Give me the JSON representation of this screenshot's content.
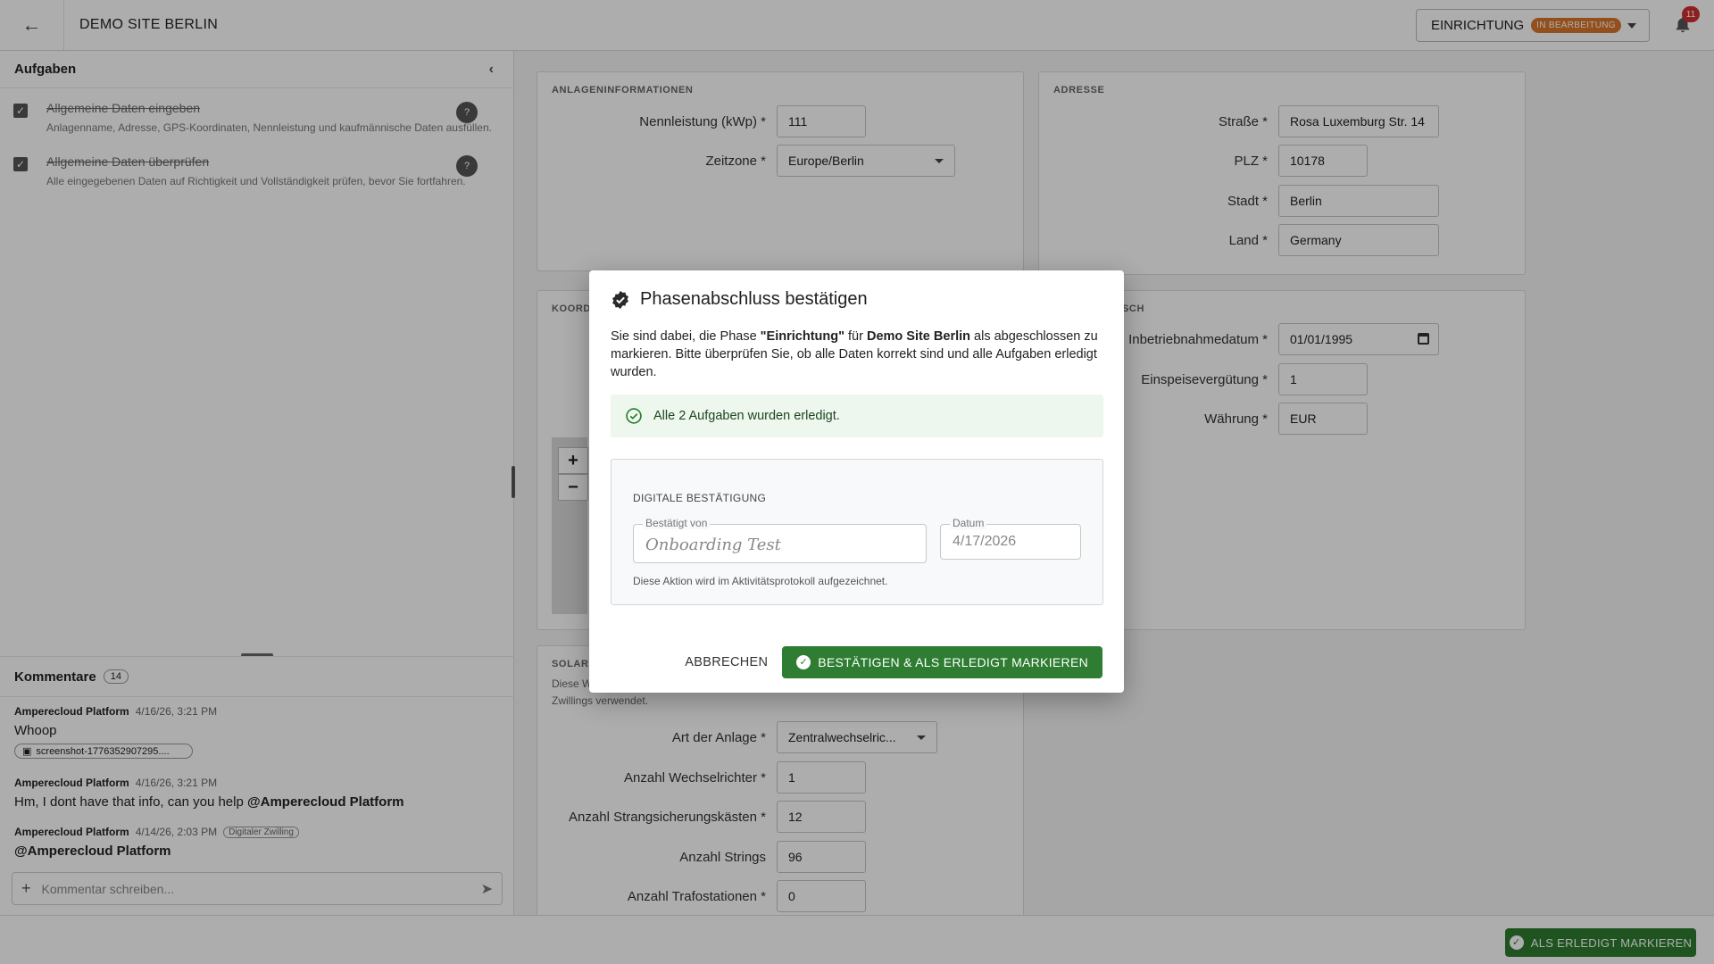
{
  "header": {
    "site_title": "DEMO SITE BERLIN",
    "phase_label": "EINRICHTUNG",
    "phase_status": "IN BEARBEITUNG",
    "notification_count": "11"
  },
  "tasks": {
    "title": "Aufgaben",
    "items": [
      {
        "title": "Allgemeine Daten eingeben",
        "description": "Anlagenname, Adresse, GPS-Koordinaten, Nennleistung und kaufmännische Daten ausfüllen.",
        "done": true
      },
      {
        "title": "Allgemeine Daten überprüfen",
        "description": "Alle eingegebenen Daten auf Richtigkeit und Vollständigkeit prüfen, bevor Sie fortfahren.",
        "done": true
      }
    ]
  },
  "comments": {
    "title": "Kommentare",
    "count": "14",
    "items": [
      {
        "author": "Amperecloud Platform",
        "time": "4/16/26, 3:21 PM",
        "text": "Whoop",
        "attachment": "screenshot-1776352907295...."
      },
      {
        "author": "Amperecloud Platform",
        "time": "4/16/26, 3:21 PM",
        "text_prefix": "Hm, I dont have that info, can you help ",
        "mention": "@Amperecloud Platform"
      },
      {
        "author": "Amperecloud Platform",
        "time": "4/14/26, 2:03 PM",
        "tag": "Digitaler Zwilling",
        "mention": "@Amperecloud Platform"
      }
    ],
    "input_placeholder": "Kommentar schreiben..."
  },
  "anlage": {
    "title": "ANLAGENINFORMATIONEN",
    "nennleistung_label": "Nennleistung (kWp) *",
    "nennleistung_value": "111",
    "zeitzone_label": "Zeitzone *",
    "zeitzone_value": "Europe/Berlin"
  },
  "adresse": {
    "title": "ADRESSE",
    "strasse_label": "Straße *",
    "strasse_value": "Rosa Luxemburg Str. 14",
    "plz_label": "PLZ *",
    "plz_value": "10178",
    "stadt_label": "Stadt *",
    "stadt_value": "Berlin",
    "land_label": "Land *",
    "land_value": "Germany"
  },
  "koord": {
    "title_fragment": "KOORD"
  },
  "kaufm": {
    "title_fragment": "SCH",
    "inbetrieb_label": "Inbetriebnahmedatum *",
    "inbetrieb_value": "01/01/1995",
    "einspeise_label": "Einspeisevergütung *",
    "einspeise_value": "1",
    "waehrung_label": "Währung *",
    "waehrung_value": "EUR"
  },
  "solar": {
    "title_fragment": "SOLAR",
    "desc_fragment_1": "Diese W",
    "desc_fragment_2": "Zwillings verwendet.",
    "art_label": "Art der Anlage *",
    "art_value": "Zentralwechselric...",
    "wr_label": "Anzahl Wechselrichter *",
    "wr_value": "1",
    "strangsich_label": "Anzahl Strangsicherungskästen *",
    "strangsich_value": "12",
    "strings_label": "Anzahl Strings",
    "strings_value": "96",
    "trafo_label": "Anzahl Trafostationen *",
    "trafo_value": "0"
  },
  "footer": {
    "mark_done": "ALS ERLEDIGT MARKIEREN"
  },
  "modal": {
    "title": "Phasenabschluss bestätigen",
    "body_1": "Sie sind dabei, die Phase ",
    "phase": "\"Einrichtung\"",
    "body_2": " für ",
    "site": "Demo Site Berlin",
    "body_3": " als abgeschlossen zu markieren. Bitte überprüfen Sie, ob alle Daten korrekt sind und alle Aufgaben erledigt wurden.",
    "success": "Alle 2 Aufgaben wurden erledigt.",
    "sig_title": "DIGITALE BESTÄTIGUNG",
    "confirmed_by_label": "Bestätigt von",
    "confirmed_by_value": "Onboarding Test",
    "date_label": "Datum",
    "date_value": "4/17/2026",
    "sig_note": "Diese Aktion wird im Aktivitätsprotokoll aufgezeichnet.",
    "cancel": "ABBRECHEN",
    "confirm": "BESTÄTIGEN & ALS ERLEDIGT MARKIEREN"
  },
  "colors": {
    "primary_green": "#2e7d32",
    "status_orange": "#d9772b",
    "badge_red": "#d32f2f",
    "success_bg": "#edf7ed"
  }
}
